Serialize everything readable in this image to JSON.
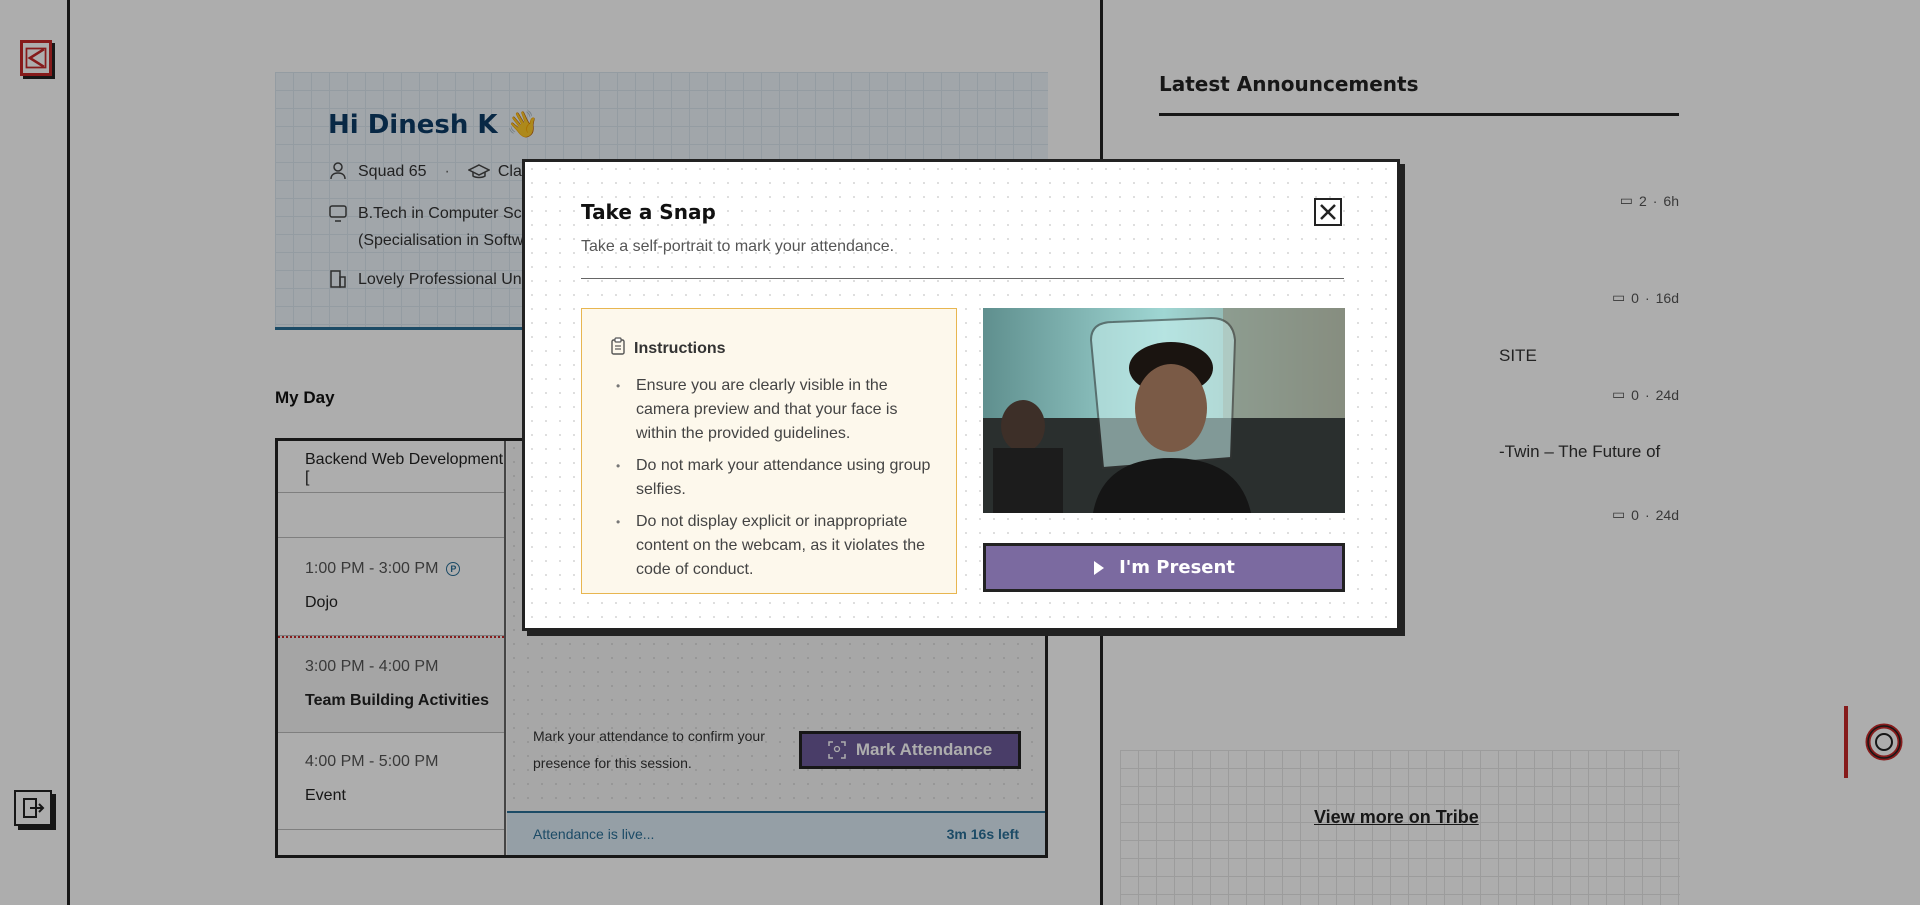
{
  "greeting": {
    "title": "Hi Dinesh K 👋"
  },
  "profile": {
    "squad": "Squad 65",
    "class_label": "Clas",
    "degree_line1": "B.Tech in Computer Sc",
    "degree_line2": "(Specialisation in Softw",
    "university": "Lovely Professional Uni"
  },
  "my_day": {
    "title": "My Day",
    "slots": [
      {
        "time": "",
        "name": "Backend Web Development ["
      },
      {
        "time": "1:00 PM - 3:00 PM",
        "name": "Dojo"
      },
      {
        "time": "3:00 PM - 4:00 PM",
        "name": "Team Building Activities"
      },
      {
        "time": "4:00 PM - 5:00 PM",
        "name": "Event"
      }
    ],
    "attendance_message": "Mark your attendance to confirm your presence for this session.",
    "mark_button": "Mark Attendance",
    "live_text": "Attendance is live...",
    "time_left": "3m 16s left"
  },
  "announcements": {
    "title": "Latest Announcements",
    "items": [
      {
        "text": "",
        "comments": "2",
        "age": "6h"
      },
      {
        "text": "",
        "comments": "0",
        "age": "16d"
      },
      {
        "text": "SITE",
        "comments": "0",
        "age": "24d"
      },
      {
        "text": "-Twin – The Future of AI-Driven",
        "comments": "0",
        "age": "24d"
      }
    ],
    "view_more": "View more on Tribe"
  },
  "modal": {
    "title": "Take a Snap",
    "subtitle": "Take a self-portrait to mark your attendance.",
    "instructions_title": "Instructions",
    "instructions": [
      "Ensure you are clearly visible in the camera preview and that your face is within the provided guidelines.",
      "Do not mark your attendance using group selfies.",
      "Do not display explicit or inappropriate content on the webcam, as it violates the code of conduct."
    ],
    "present_button": "I'm Present"
  },
  "colors": {
    "brand_red": "#c62828",
    "accent_blue": "#2a6f97",
    "button_purple": "#7b6aa0",
    "instructions_bg": "#fdf8ec"
  }
}
